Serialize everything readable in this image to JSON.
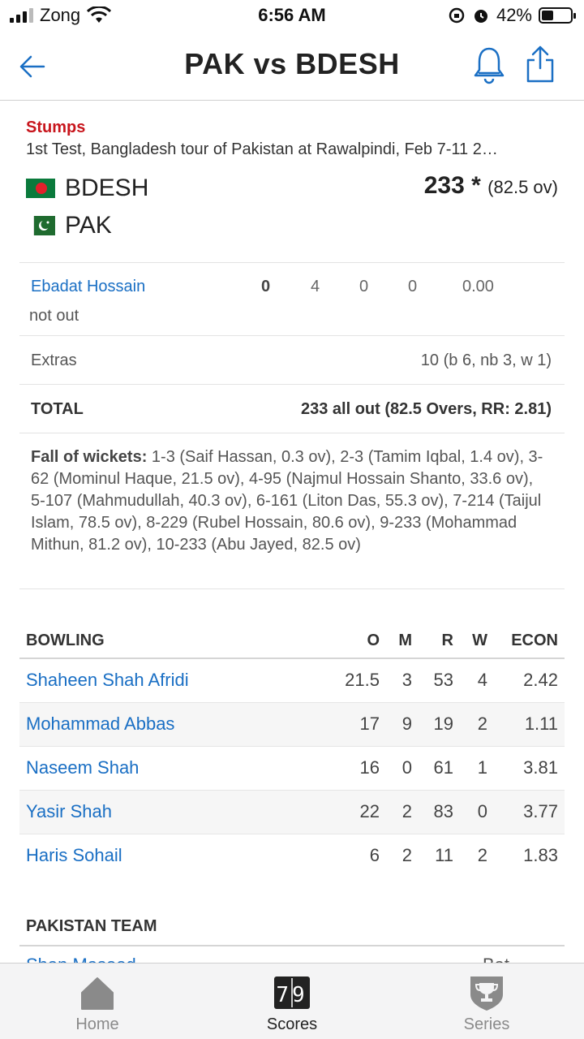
{
  "status_bar": {
    "carrier": "Zong",
    "time": "6:56 AM",
    "battery": "42%",
    "battery_level": 0.42
  },
  "header": {
    "title": "PAK vs BDESH"
  },
  "match": {
    "status": "Stumps",
    "info": "1st Test, Bangladesh tour of Pakistan at Rawalpindi, Feb 7-11 2…",
    "team1": {
      "name": "BDESH",
      "score": "233",
      "score_marker": "*",
      "overs": "(82.5 ov)"
    },
    "team2": {
      "name": "PAK"
    }
  },
  "batting": {
    "batter": {
      "name": "Ebadat Hossain",
      "dismissal": "not out",
      "runs": "0",
      "balls": "4",
      "fours": "0",
      "sixes": "0",
      "sr": "0.00"
    },
    "extras": {
      "label": "Extras",
      "value": "10 (b 6, nb 3, w 1)"
    },
    "total": {
      "label": "TOTAL",
      "value": "233 all out (82.5 Overs, RR: 2.81)"
    },
    "fow": {
      "label": "Fall of wickets:",
      "text": " 1-3 (Saif Hassan, 0.3 ov), 2-3 (Tamim Iqbal, 1.4 ov), 3-62 (Mominul Haque, 21.5 ov), 4-95 (Najmul Hossain Shanto, 33.6 ov), 5-107 (Mahmudullah, 40.3 ov), 6-161 (Liton Das, 55.3 ov), 7-214 (Taijul Islam, 78.5 ov), 8-229 (Rubel Hossain, 80.6 ov), 9-233 (Mohammad Mithun, 81.2 ov), 10-233 (Abu Jayed, 82.5 ov)"
    }
  },
  "bowling": {
    "headers": {
      "name": "BOWLING",
      "o": "O",
      "m": "M",
      "r": "R",
      "w": "W",
      "econ": "ECON"
    },
    "rows": [
      {
        "name": "Shaheen Shah Afridi",
        "o": "21.5",
        "m": "3",
        "r": "53",
        "w": "4",
        "econ": "2.42"
      },
      {
        "name": "Mohammad Abbas",
        "o": "17",
        "m": "9",
        "r": "19",
        "w": "2",
        "econ": "1.11"
      },
      {
        "name": "Naseem Shah",
        "o": "16",
        "m": "0",
        "r": "61",
        "w": "1",
        "econ": "3.81"
      },
      {
        "name": "Yasir Shah",
        "o": "22",
        "m": "2",
        "r": "83",
        "w": "0",
        "econ": "3.77"
      },
      {
        "name": "Haris Sohail",
        "o": "6",
        "m": "2",
        "r": "11",
        "w": "2",
        "econ": "1.83"
      }
    ]
  },
  "team_section": {
    "title": "PAKISTAN TEAM",
    "peek_name": "Shan Masood",
    "peek_role": "Bat"
  },
  "tabbar": {
    "tabs": [
      {
        "label": "Home",
        "icon": "home-icon"
      },
      {
        "label": "Scores",
        "icon": "scoreboard-icon",
        "icon_text": "79"
      },
      {
        "label": "Series",
        "icon": "trophy-icon"
      }
    ],
    "active": "Scores"
  },
  "colors": {
    "accent": "#1a6fc4",
    "status": "#c8161d"
  }
}
